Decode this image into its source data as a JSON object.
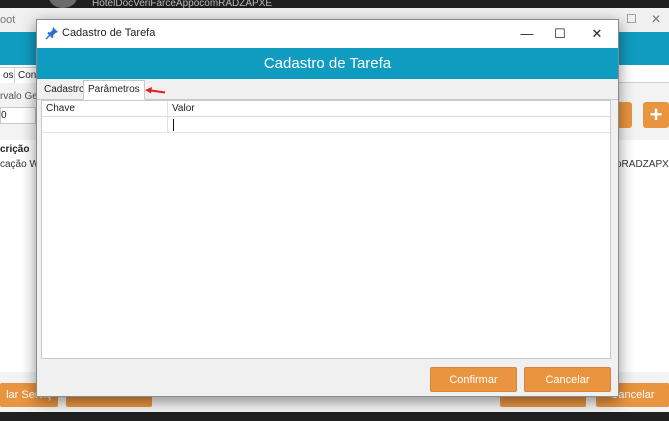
{
  "background": {
    "peek_text": "HotelDocVeriFarceAppocomRADZAPXE",
    "app_title": "oot",
    "tabs": [
      "os",
      "Cone"
    ],
    "label": "rvalo Ger",
    "input_value": "0",
    "column_header": "crição",
    "row_left": "cação WI",
    "row_right": "oRADZAPXE",
    "buttons": {
      "left": "lar Serviç",
      "right": "Cancelar"
    }
  },
  "dialog": {
    "window_title": "Cadastro de Tarefa",
    "header_title": "Cadastro de Tarefa",
    "tabs": [
      {
        "label": "Cadastro",
        "active": false
      },
      {
        "label": "Parâmetros",
        "active": true
      }
    ],
    "grid": {
      "columns": [
        "Chave",
        "Valor"
      ]
    },
    "buttons": {
      "confirm": "Confirmar",
      "cancel": "Cancelar"
    },
    "controls": {
      "minimize": "—",
      "maximize": "☐",
      "close": "✕"
    }
  },
  "colors": {
    "header": "#109cc1",
    "accent_button": "#e9953f",
    "annotation_arrow": "#e0201a"
  }
}
